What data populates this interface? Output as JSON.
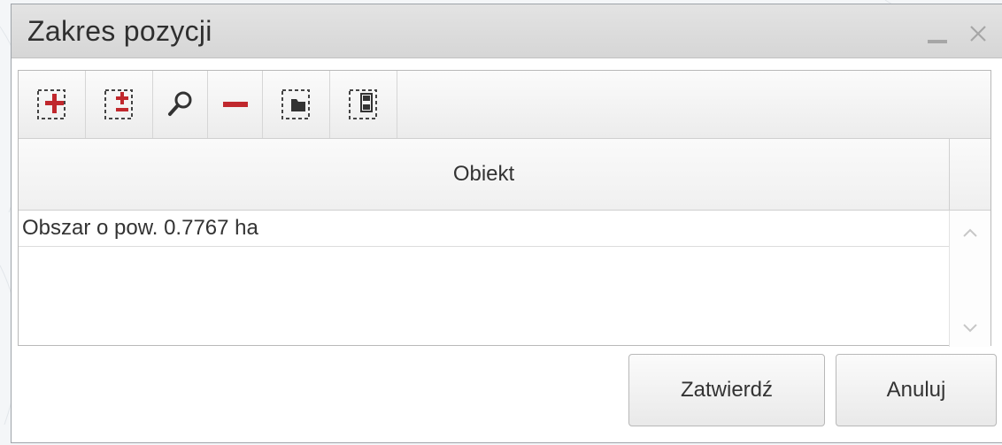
{
  "window": {
    "title": "Zakres pozycji"
  },
  "toolbar": {
    "buttons": [
      {
        "icon": "add-selection-icon",
        "color": "#c0282d"
      },
      {
        "icon": "add-remove-selection-icon",
        "color": "#c0282d"
      },
      {
        "icon": "search-icon",
        "color": "#333333"
      },
      {
        "icon": "remove-icon",
        "color": "#c0282d"
      },
      {
        "icon": "open-folder-icon",
        "color": "#333333"
      },
      {
        "icon": "save-icon",
        "color": "#333333"
      }
    ]
  },
  "grid": {
    "column_header": "Obiekt",
    "rows": [
      {
        "obiekt": "Obszar o pow. 0.7767 ha"
      }
    ]
  },
  "actions": {
    "confirm_label": "Zatwierdź",
    "cancel_label": "Anuluj"
  }
}
